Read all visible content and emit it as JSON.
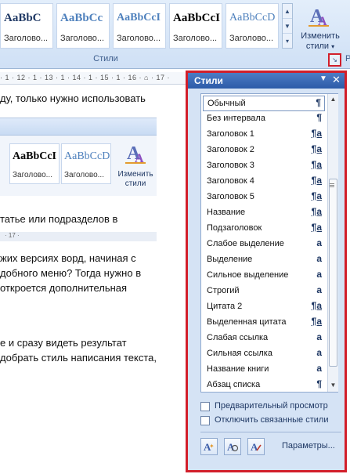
{
  "ribbon": {
    "gallery": [
      {
        "sample": "AaBbC",
        "label": "Заголово..."
      },
      {
        "sample": "AaBbCc",
        "label": "Заголово..."
      },
      {
        "sample": "AaBbCcI",
        "label": "Заголово..."
      },
      {
        "sample": "AaBbCcI",
        "label": "Заголово..."
      },
      {
        "sample": "AaBbCcD",
        "label": "Заголово..."
      }
    ],
    "change_styles_label_line1": "Изменить",
    "change_styles_label_line2": "стили",
    "group_name": "Стили",
    "edge_letter": "Р"
  },
  "ruler": {
    "text": "· 1 · 12 · 1 · 13 · 1 · 14 · 1 · 15 · 1 · 16 · ⌂ · 17 ·"
  },
  "document": {
    "lines": [
      "ду, только нужно использовать",
      "татье или подразделов в",
      "жих версиях ворд, начиная с",
      "добного меню? Тогда нужно в",
      "откроется дополнительная",
      "е   и   сразу   видеть   результат",
      "добрать стиль написания текста,"
    ],
    "embed": {
      "tiles": [
        {
          "sample": "AaBbCcI",
          "label": "Заголово..."
        },
        {
          "sample": "AaBbCcD",
          "label": "Заголово..."
        }
      ],
      "change_line1": "Изменить",
      "change_line2": "стили",
      "ruler": "· 17 ·"
    }
  },
  "pane": {
    "title": "Стили",
    "styles": [
      {
        "name": "Обычный",
        "mark": "¶"
      },
      {
        "name": "Без интервала",
        "mark": "¶"
      },
      {
        "name": "Заголовок 1",
        "mark": "¶a"
      },
      {
        "name": "Заголовок 2",
        "mark": "¶a"
      },
      {
        "name": "Заголовок 3",
        "mark": "¶a"
      },
      {
        "name": "Заголовок 4",
        "mark": "¶a"
      },
      {
        "name": "Заголовок 5",
        "mark": "¶a"
      },
      {
        "name": "Название",
        "mark": "¶a"
      },
      {
        "name": "Подзаголовок",
        "mark": "¶a"
      },
      {
        "name": "Слабое выделение",
        "mark": "a"
      },
      {
        "name": "Выделение",
        "mark": "a"
      },
      {
        "name": "Сильное выделение",
        "mark": "a"
      },
      {
        "name": "Строгий",
        "mark": "a"
      },
      {
        "name": "Цитата 2",
        "mark": "¶a"
      },
      {
        "name": "Выделенная цитата",
        "mark": "¶a"
      },
      {
        "name": "Слабая ссылка",
        "mark": "a"
      },
      {
        "name": "Сильная ссылка",
        "mark": "a"
      },
      {
        "name": "Название книги",
        "mark": "a"
      },
      {
        "name": "Абзац списка",
        "mark": "¶"
      }
    ],
    "preview_label": "Предварительный просмотр",
    "disable_linked_label": "Отключить связанные стили",
    "options_link": "Параметры..."
  }
}
